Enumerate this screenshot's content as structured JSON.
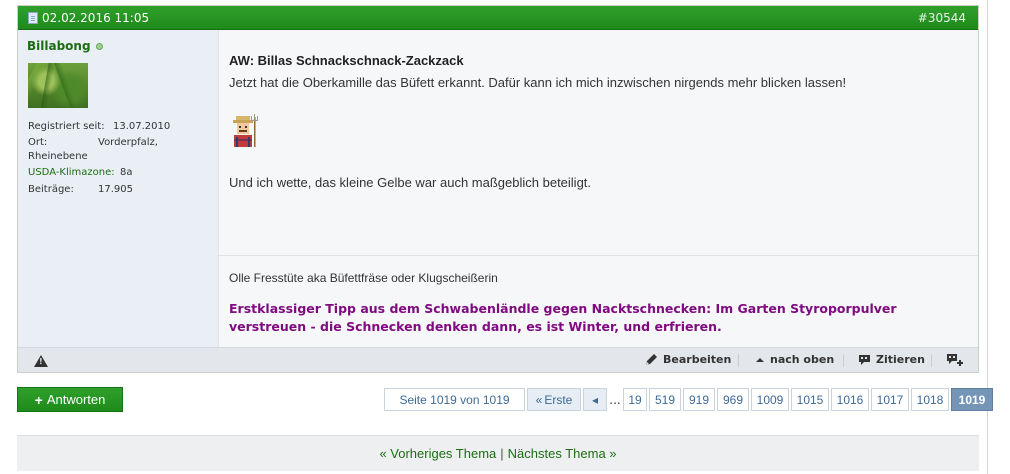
{
  "post": {
    "date": "02.02.2016 11:05",
    "number": "#30544",
    "user": {
      "name": "Billabong",
      "registered_label": "Registriert seit:",
      "registered_value": "13.07.2010",
      "location_label": "Ort:",
      "location_value": "Vorderpfalz,",
      "location_value2": "Rheinebene",
      "zone_label": "USDA-Klimazone:",
      "zone_value": "8a",
      "posts_label": "Beiträge:",
      "posts_value": "17.905"
    },
    "title": "AW: Billas Schnackschnack-Zackzack",
    "text1": "Jetzt hat die Oberkamille das Büfett erkannt. Dafür kann ich mich inzwischen nirgends mehr blicken lassen!",
    "text2": "Und ich wette, das kleine Gelbe war auch maßgeblich beteiligt.",
    "signature1": "Olle Fresstüte aka Büfettfräse oder Klugscheißerin",
    "signature2": "Erstklassiger Tipp aus dem Schwabenländle gegen Nacktschnecken: Im Garten Styroporpulver verstreuen - die Schnecken denken dann, es ist Winter, und erfrieren.",
    "actions": {
      "edit": "Bearbeiten",
      "top": "nach oben",
      "quote": "Zitieren"
    }
  },
  "reply_button": "Antworten",
  "pagination": {
    "info": "Seite 1019 von 1019",
    "first": "Erste",
    "dots": "...",
    "pages": [
      "19",
      "519",
      "919",
      "969",
      "1009",
      "1015",
      "1016",
      "1017",
      "1018"
    ],
    "current": "1019"
  },
  "thread_nav": {
    "prev": "« Vorheriges Thema",
    "separator": "|",
    "next": "Nächstes Thema »"
  }
}
